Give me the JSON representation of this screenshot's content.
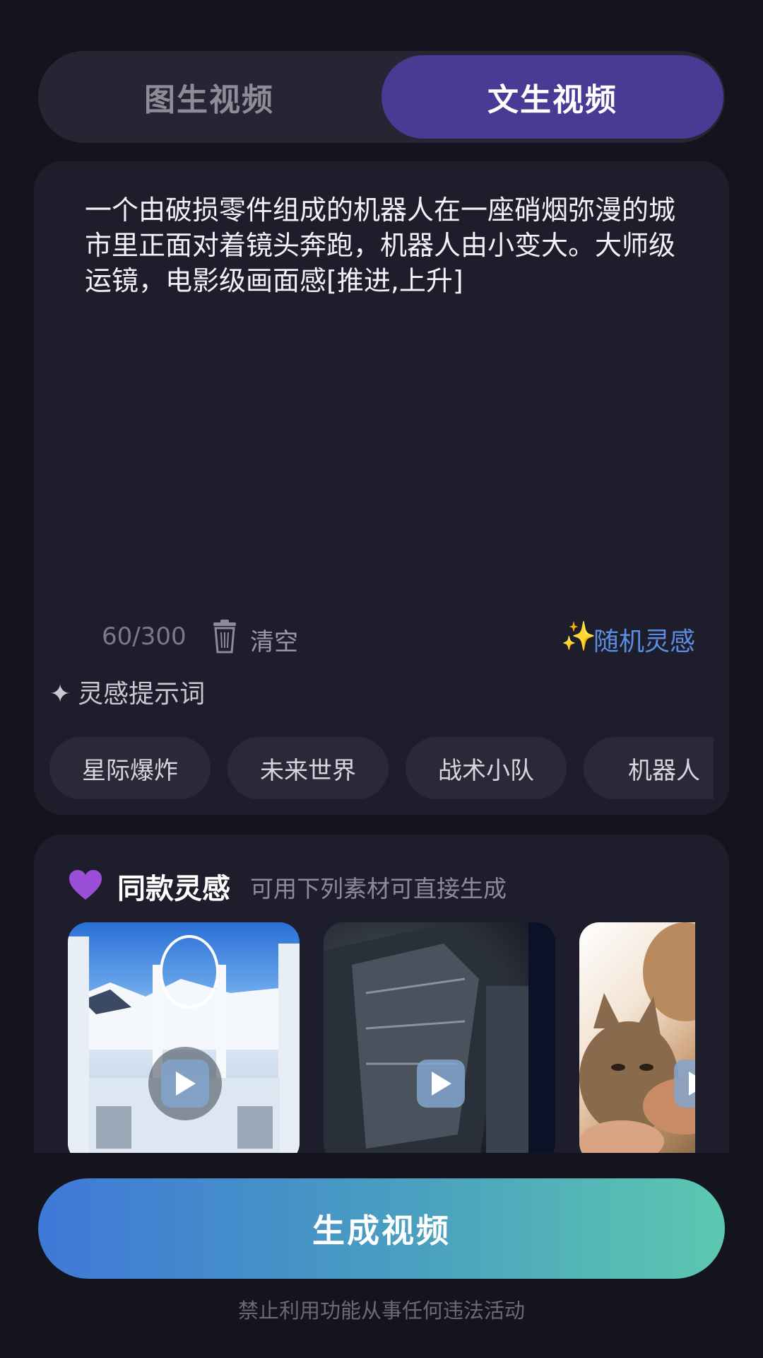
{
  "tabs": [
    {
      "label": "图生视频",
      "active": false
    },
    {
      "label": "文生视频",
      "active": true
    }
  ],
  "prompt": {
    "text": "一个由破损零件组成的机器人在一座硝烟弥漫的城市里正面对着镜头奔跑，机器人由小变大。大师级运镜，电影级画面感[推进,上升]",
    "counter": "60/300",
    "clear_label": "清空",
    "random_label": "随机灵感"
  },
  "hints": {
    "title": "灵感提示词",
    "chips": [
      "星际爆炸",
      "未来世界",
      "战术小队",
      "机器人"
    ]
  },
  "inspiration": {
    "title": "同款灵感",
    "subtitle": "可用下列素材可直接生成",
    "thumbnails": [
      {
        "subject": "snowy ice castle"
      },
      {
        "subject": "sci-fi spaceship hull"
      },
      {
        "subject": "person hugging cat"
      }
    ]
  },
  "generate_button": "生成视频",
  "footer_note": "禁止利用功能从事任何违法活动",
  "colors": {
    "background": "#14141f",
    "card": "#1d1d2c",
    "active_tab": "#4b3a94",
    "accent_link": "#5b8de0",
    "button_gradient": [
      "#3f78d8",
      "#5cc8b0"
    ]
  }
}
